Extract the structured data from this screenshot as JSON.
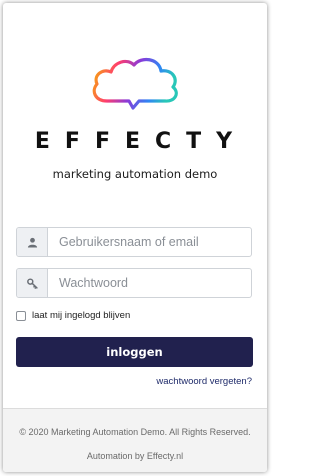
{
  "brand": {
    "name": "EFFECTY",
    "subtitle": "marketing automation demo",
    "logo_icon": "cloud-logo-icon",
    "gradient_colors": [
      "#f5b400",
      "#ff3d6e",
      "#8a3ad8",
      "#2f86f4",
      "#28c7b8"
    ]
  },
  "form": {
    "username": {
      "placeholder": "Gebruikersnaam of email",
      "value": "",
      "icon": "user-icon"
    },
    "password": {
      "placeholder": "Wachtwoord",
      "value": "",
      "icon": "key-icon"
    },
    "remember_label": "laat mij ingelogd blijven",
    "remember_checked": false,
    "submit_label": "inloggen",
    "forgot_label": "wachtwoord vergeten?"
  },
  "footer": {
    "copyright": "© 2020 Marketing Automation Demo. All Rights Reserved.",
    "credit": "Automation by Effecty.nl"
  },
  "colors": {
    "button_bg": "#21214e",
    "link": "#1f2b6a",
    "footer_bg": "#f3f3f3"
  }
}
